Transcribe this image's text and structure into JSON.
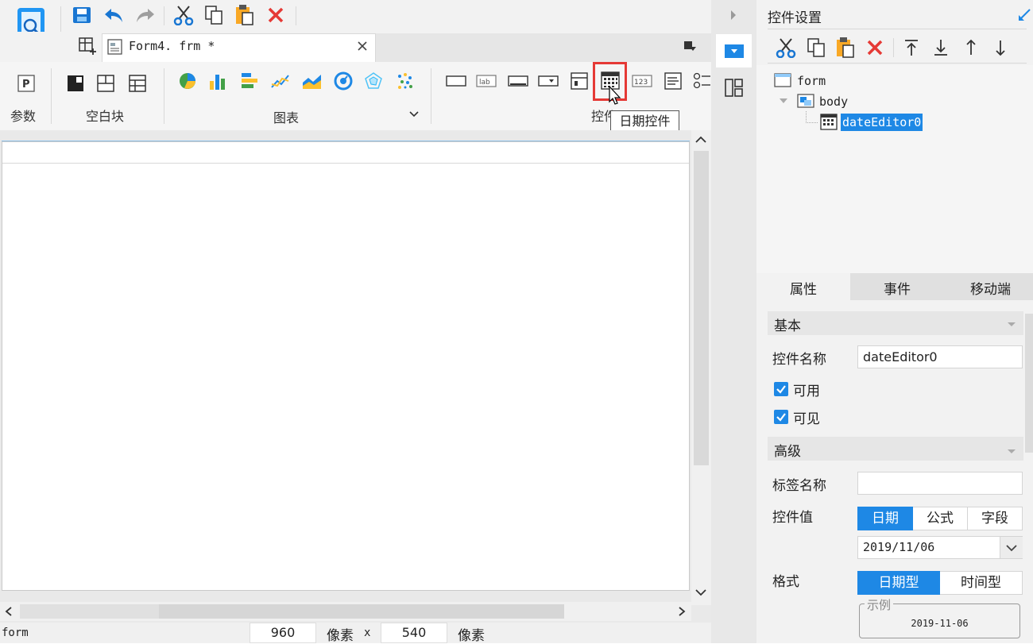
{
  "toolbar": {
    "tab_title": "Form4. frm *"
  },
  "ribbon": {
    "groups": {
      "params": "参数",
      "blank_block": "空白块",
      "chart": "图表",
      "controls": "控件"
    },
    "tooltip": "日期控件"
  },
  "status": {
    "left_text": "form",
    "width_value": "960",
    "width_unit": "像素",
    "times": "x",
    "height_value": "540",
    "height_unit": "像素"
  },
  "right_panel": {
    "title": "控件设置",
    "tree": {
      "root": "form",
      "body": "body",
      "leaf": "dateEditor0"
    },
    "tabs": [
      "属性",
      "事件",
      "移动端"
    ],
    "sections": {
      "basic": "基本",
      "advanced": "高级"
    },
    "props": {
      "name_label": "控件名称",
      "name_value": "dateEditor0",
      "enabled_label": "可用",
      "visible_label": "可见",
      "tag_label": "标签名称",
      "tag_value": "",
      "value_label": "控件值",
      "value_modes": [
        "日期",
        "公式",
        "字段"
      ],
      "date_value": "2019/11/06",
      "format_label": "格式",
      "format_modes": [
        "日期型",
        "时间型"
      ],
      "example_label": "示例",
      "example_value": "2019-11-06"
    }
  },
  "colors": {
    "accent": "#1e88e5",
    "highlight_box": "#e53935"
  }
}
